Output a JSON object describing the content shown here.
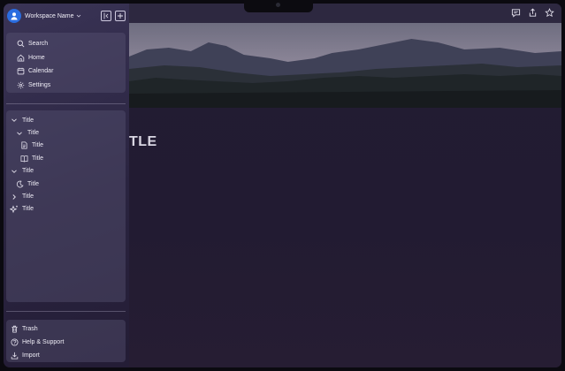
{
  "workspace": {
    "name": "Workspace Name"
  },
  "nav": [
    {
      "icon": "search-icon",
      "label": "Search"
    },
    {
      "icon": "home-icon",
      "label": "Home"
    },
    {
      "icon": "calendar-icon",
      "label": "Calendar"
    },
    {
      "icon": "gear-icon",
      "label": "Settings"
    }
  ],
  "tree": [
    {
      "icon": "chevron-down-icon",
      "label": "Title",
      "level": 0
    },
    {
      "icon": "chevron-down-icon",
      "label": "Title",
      "level": 1
    },
    {
      "icon": "document-icon",
      "label": "Title",
      "level": 2
    },
    {
      "icon": "book-icon",
      "label": "Title",
      "level": 2
    },
    {
      "icon": "chevron-down-icon",
      "label": "Title",
      "level": 0
    },
    {
      "icon": "moon-icon",
      "label": "Title",
      "level": 1
    },
    {
      "icon": "chevron-right-icon",
      "label": "Title",
      "level": 0
    },
    {
      "icon": "sparkle-icon",
      "label": "Title",
      "level": 0
    }
  ],
  "footer": [
    {
      "icon": "trash-icon",
      "label": "Trash"
    },
    {
      "icon": "help-icon",
      "label": "Help & Support"
    },
    {
      "icon": "download-icon",
      "label": "Import"
    }
  ],
  "page": {
    "title": "TLE"
  }
}
